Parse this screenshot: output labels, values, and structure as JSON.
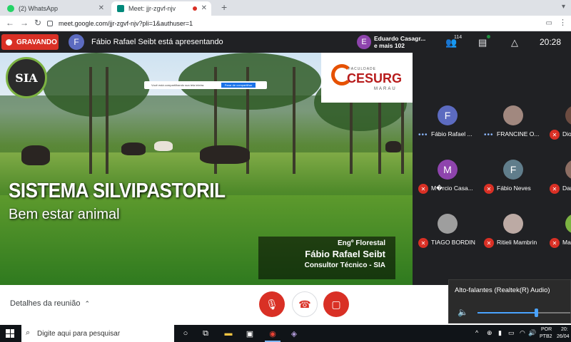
{
  "browser": {
    "tabs": [
      {
        "label": "(2) WhatsApp",
        "active": false,
        "favicon_color": "#25d366"
      },
      {
        "label": "Meet: jjr-zgvf-njv",
        "active": true,
        "favicon_color": "#00897b"
      }
    ],
    "url": "meet.google.com/jjr-zgvf-njv?pli=1&authuser=1"
  },
  "meet": {
    "recording_label": "GRAVANDO",
    "presenter_initial": "F",
    "presenting_text": "Fábio Rafael Seibt está apresentando",
    "others": {
      "initial": "E",
      "line1": "Eduardo Casagr...",
      "line2": "e mais 102"
    },
    "participant_count": "114",
    "time": "20:28"
  },
  "presentation": {
    "logo_text": "SIA",
    "share_notice": "Você está compartilhando sua tela inteira.",
    "share_stop_button": "Parar de compartilhar",
    "institution": {
      "small": "FACULDADE",
      "name": "CESURG",
      "city": "MARAU"
    },
    "title": "SISTEMA SILVIPASTORIL",
    "subtitle": "Bem estar animal",
    "credit": {
      "line1": "Engº Florestal",
      "line2": "Fábio Rafael Seibt",
      "line3": "Consultor Técnico - SIA"
    }
  },
  "participants": [
    {
      "name": "Fábio Rafael ...",
      "initial": "F",
      "color": "#5c6bc0",
      "status": "speaking"
    },
    {
      "name": "FRANCINE O...",
      "initial": "",
      "color": "#a1887f",
      "status": "speaking"
    },
    {
      "name": "Dio",
      "initial": "",
      "color": "#6d4c41",
      "status": "muted"
    },
    {
      "name": "M�rcio Casa...",
      "initial": "M",
      "color": "#8e44ad",
      "status": "muted"
    },
    {
      "name": "Fábio Neves",
      "initial": "F",
      "color": "#607d8b",
      "status": "muted"
    },
    {
      "name": "Dar",
      "initial": "",
      "color": "#8d6e63",
      "status": "muted"
    },
    {
      "name": "TIAGO BORDIN",
      "initial": "",
      "color": "#9e9e9e",
      "status": "muted"
    },
    {
      "name": "Ritieli Mambrin",
      "initial": "",
      "color": "#bcaaa4",
      "status": "muted"
    },
    {
      "name": "Ma",
      "initial": "",
      "color": "#7cb342",
      "status": "muted"
    }
  ],
  "bottom": {
    "details_label": "Detalhes da reunião"
  },
  "volume": {
    "device": "Alto-falantes (Realtek(R) Audio)",
    "level_fraction": 0.63
  },
  "taskbar": {
    "search_placeholder": "Digite aqui para pesquisar",
    "lang_line1": "POR",
    "lang_line2": "PTB2",
    "clock_line1": "20:",
    "clock_line2": "26/04"
  }
}
